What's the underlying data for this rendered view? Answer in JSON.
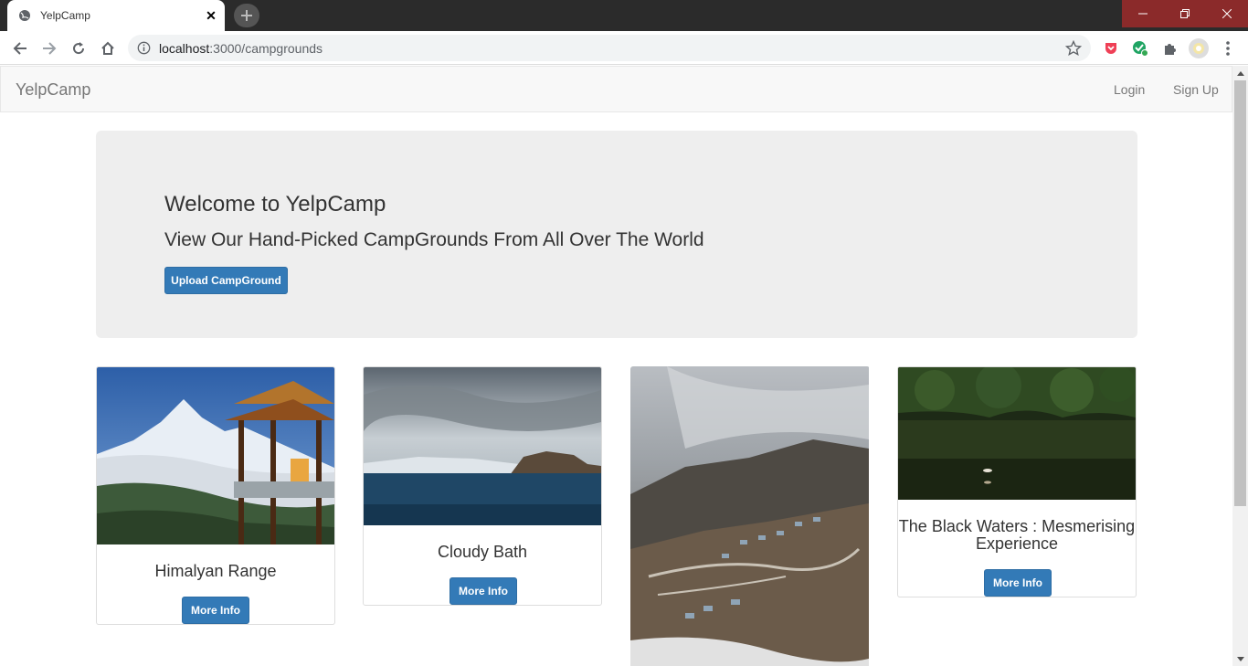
{
  "browser": {
    "tab_title": "YelpCamp",
    "url_host": "localhost",
    "url_path": ":3000/campgrounds"
  },
  "navbar": {
    "brand": "YelpCamp",
    "login": "Login",
    "signup": "Sign Up"
  },
  "jumbotron": {
    "title": "Welcome to YelpCamp",
    "subtitle": "View Our Hand-Picked CampGrounds From All Over The World",
    "upload_button": "Upload CampGround"
  },
  "campgrounds": [
    {
      "name": "Himalyan Range",
      "button": "More Info"
    },
    {
      "name": "Cloudy Bath",
      "button": "More Info"
    },
    {
      "name": "",
      "button": ""
    },
    {
      "name": "The Black Waters : Mesmerising Experience",
      "button": "More Info"
    }
  ],
  "colors": {
    "primary": "#337ab7",
    "navbar_bg": "#f8f8f8",
    "jumbotron_bg": "#eeeeee"
  }
}
